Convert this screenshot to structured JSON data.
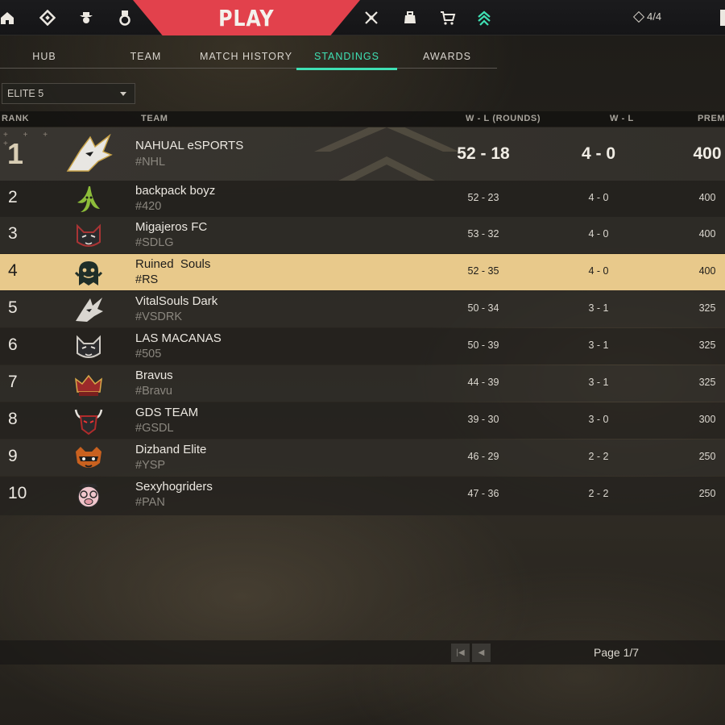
{
  "nav": {
    "icons": [
      "home-icon",
      "career-icon",
      "agents-icon",
      "collection-icon",
      "battlepass-icon",
      "agent-contracts-icon",
      "store-icon",
      "premier-icon"
    ],
    "play_label": "PLAY",
    "points": "4/4",
    "accent": "#e2414c"
  },
  "subtabs": {
    "items": [
      "HUB",
      "TEAM",
      "MATCH HISTORY",
      "STANDINGS",
      "AWARDS"
    ],
    "active": "STANDINGS",
    "active_color": "#3fe0b4"
  },
  "division_select": {
    "value": "ELITE 5"
  },
  "table": {
    "headers": {
      "rank": "RANK",
      "team": "TEAM",
      "wl_rounds": "W - L (ROUNDS)",
      "wl": "W - L",
      "premier": "PREMI"
    },
    "rows": [
      {
        "rank": "1",
        "name": "NAHUAL eSPORTS",
        "tag": "#NHL",
        "wl_rounds": "52 - 18",
        "wl": "4 - 0",
        "premier": "400",
        "logo": "wolf-logo"
      },
      {
        "rank": "2",
        "name": "backpack boyz",
        "tag": "#420",
        "wl_rounds": "52 - 23",
        "wl": "4 - 0",
        "premier": "400",
        "logo": "banana-logo"
      },
      {
        "rank": "3",
        "name": "Migajeros FC",
        "tag": "#SDLG",
        "wl_rounds": "53 - 32",
        "wl": "4 - 0",
        "premier": "400",
        "logo": "cat-logo"
      },
      {
        "rank": "4",
        "name": "Ruined  Souls",
        "tag": "#RS",
        "wl_rounds": "52 - 35",
        "wl": "4 - 0",
        "premier": "400",
        "logo": "ghost-logo"
      },
      {
        "rank": "5",
        "name": "VitalSouls Dark",
        "tag": "#VSDRK",
        "wl_rounds": "50 - 34",
        "wl": "3 - 1",
        "premier": "325",
        "logo": "wolf-logo"
      },
      {
        "rank": "6",
        "name": "LAS MACANAS",
        "tag": "#505",
        "wl_rounds": "50 - 39",
        "wl": "3 - 1",
        "premier": "325",
        "logo": "cat-logo"
      },
      {
        "rank": "7",
        "name": "Bravus",
        "tag": "#Bravu",
        "wl_rounds": "44 - 39",
        "wl": "3 - 1",
        "premier": "325",
        "logo": "crown-logo"
      },
      {
        "rank": "8",
        "name": "GDS TEAM",
        "tag": "#GSDL",
        "wl_rounds": "39 - 30",
        "wl": "3 - 0",
        "premier": "300",
        "logo": "bull-logo"
      },
      {
        "rank": "9",
        "name": "Dizband Elite",
        "tag": "#YSP",
        "wl_rounds": "46 - 29",
        "wl": "2 - 2",
        "premier": "250",
        "logo": "raccoon-logo"
      },
      {
        "rank": "10",
        "name": "Sexyhogriders",
        "tag": "#PAN",
        "wl_rounds": "47 - 36",
        "wl": "2 - 2",
        "premier": "250",
        "logo": "pig-logo"
      }
    ],
    "highlight_color": "#e8c98b"
  },
  "pagination": {
    "label": "Page 1/7"
  }
}
